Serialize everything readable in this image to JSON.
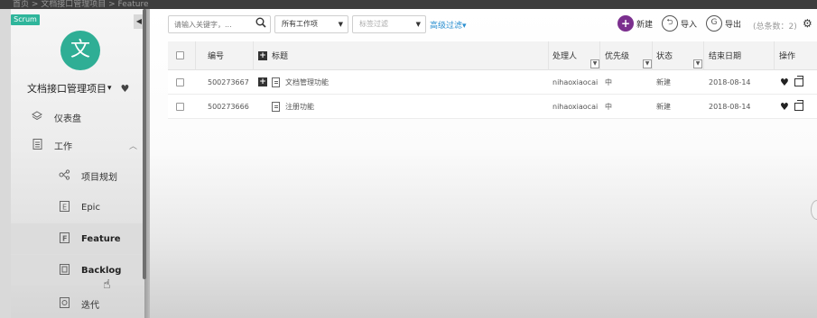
{
  "breadcrumb": "首页 > 文档接口管理项目 > Feature",
  "sidebar": {
    "tag": "Scrum",
    "avatar_letter": "文",
    "project_name": "文档接口管理项目",
    "project_caret": "▾",
    "heart_icon": "♥",
    "items": [
      {
        "label": "仪表盘",
        "icon": "layers-icon"
      },
      {
        "label": "工作",
        "icon": "work-list-icon"
      },
      {
        "label": "项目规划",
        "icon": "project-plan-icon"
      },
      {
        "label": "Epic",
        "icon": "epic-icon"
      },
      {
        "label": "Feature",
        "icon": "feature-icon"
      },
      {
        "label": "Backlog",
        "icon": "backlog-icon"
      },
      {
        "label": "迭代",
        "icon": "iteration-icon"
      }
    ]
  },
  "toolbar": {
    "search_placeholder": "请输入关键字，...",
    "type_select": "所有工作项",
    "tag_filter": "标签过滤",
    "advanced_filter": "高级过滤▾",
    "new_label": "新建",
    "import_label": "导入",
    "export_label": "导出",
    "total": "(总条数：2)"
  },
  "table": {
    "headers": {
      "id": "编号",
      "title": "标题",
      "assignee": "处理人",
      "priority": "优先级",
      "status": "状态",
      "end_date": "结束日期",
      "actions": "操作"
    },
    "rows": [
      {
        "id": "500273667",
        "title": "文档管理功能",
        "assignee": "nihaoxiaocai",
        "priority": "中",
        "status": "新建",
        "end_date": "2018-08-14",
        "expandable": true
      },
      {
        "id": "500273666",
        "title": "注册功能",
        "assignee": "nihaoxiaocai",
        "priority": "中",
        "status": "新建",
        "end_date": "2018-08-14",
        "expandable": false
      }
    ]
  },
  "colors": {
    "accent_green": "#2fae95",
    "new_button": "#7b2f8e",
    "link_blue": "#2a8fd0"
  }
}
